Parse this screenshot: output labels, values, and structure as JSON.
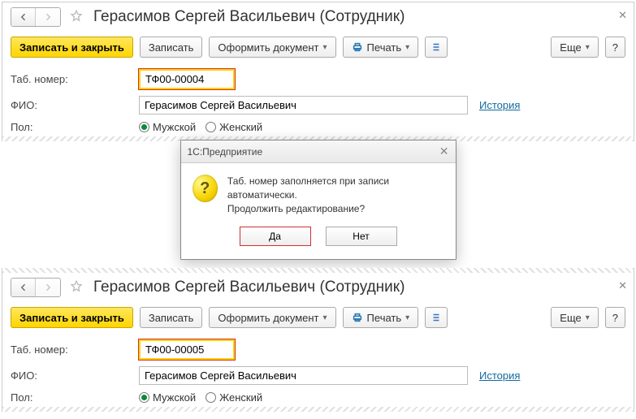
{
  "toolbar": {
    "record_and_close": "Записать и закрыть",
    "record": "Записать",
    "issue_doc": "Оформить документ",
    "print": "Печать",
    "more": "Еще"
  },
  "form": {
    "tabnum_label": "Таб. номер:",
    "fio_label": "ФИО:",
    "pol_label": "Пол:",
    "fio_value": "Герасимов Сергей Васильевич",
    "history": "История",
    "male": "Мужской",
    "female": "Женский"
  },
  "panel1": {
    "title": "Герасимов Сергей Васильевич (Сотрудник)",
    "tabnum_value": "ТФ00-00004"
  },
  "panel2": {
    "title": "Герасимов Сергей Васильевич (Сотрудник)",
    "tabnum_value": "ТФ00-00005"
  },
  "dialog": {
    "title": "1С:Предприятие",
    "line1": "Таб. номер заполняется при записи автоматически.",
    "line2": "Продолжить редактирование?",
    "yes": "Да",
    "no": "Нет"
  }
}
